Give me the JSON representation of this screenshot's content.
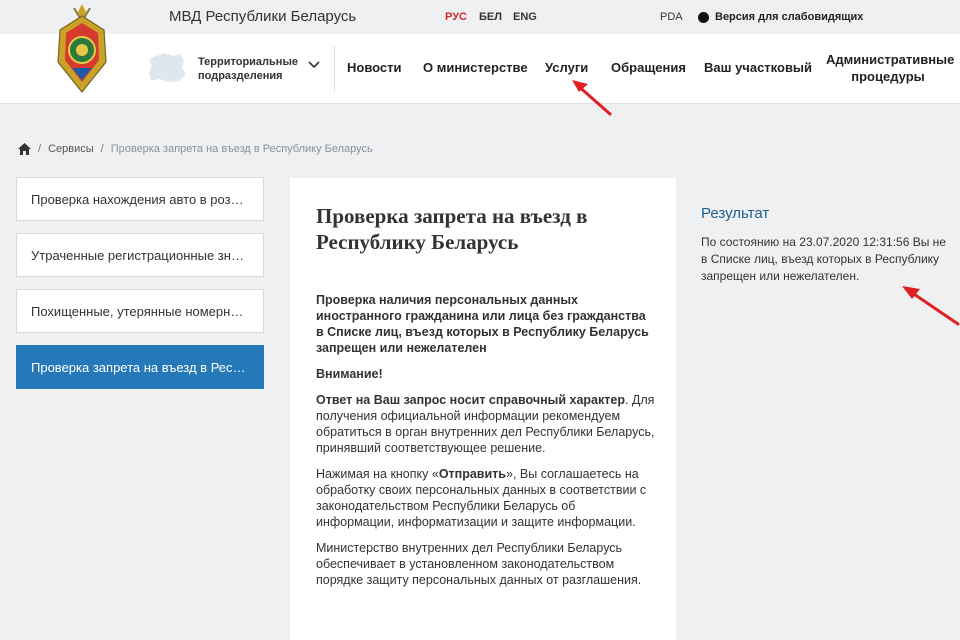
{
  "topbar": {
    "site_title": "МВД Республики Беларусь",
    "languages": [
      "РУС",
      "БЕЛ",
      "ENG"
    ],
    "active_language": "РУС",
    "pda_label": "PDA",
    "vision_label": "Версия для слабовидящих"
  },
  "header": {
    "territorial_line1": "Территориальные",
    "territorial_line2": "подразделения",
    "nav": [
      "Новости",
      "О министерстве",
      "Услуги",
      "Обращения",
      "Ваш участковый"
    ],
    "admin_line1": "Административные",
    "admin_line2": "процедуры"
  },
  "breadcrumb": {
    "services": "Сервисы",
    "current": "Проверка запрета на въезд в Республику Беларусь"
  },
  "sidebar": {
    "items": [
      {
        "label": "Проверка нахождения авто в розыске",
        "active": false
      },
      {
        "label": "Утраченные регистрационные знаки",
        "active": false
      },
      {
        "label": "Похищенные, утерянные номерные знаки",
        "active": false
      },
      {
        "label": "Проверка запрета на въезд в Республику Беларусь",
        "active": true
      }
    ]
  },
  "main": {
    "title": "Проверка запрета на въезд в Республику Беларусь",
    "intro_bold": "Проверка наличия персональных данных иностранного гражданина или лица без гражданства в Списке лиц, въезд которых в Республику Беларусь запрещен или нежелателен",
    "attention": "Внимание!",
    "reference_bold": "Ответ на Ваш запрос носит справочный характер",
    "reference_rest": ". Для получения официальной информации рекомендуем обратиться в орган внутренних дел Республики Беларусь, принявший соответствующее решение.",
    "consent_before": "Нажимая на кнопку «",
    "consent_button": "Отправить",
    "consent_after": "», Вы соглашаетесь на обработку своих персональных данных в соответствии с законодательством Республики Беларусь об информации, информатизации и защите информации.",
    "ministry_text": "Министерство внутренних дел Республики Беларусь обеспечивает в установленном законодательством порядке защиту персональных данных от разглашения."
  },
  "result": {
    "title": "Результат",
    "line1": "По состоянию на 23.07.2020 12:31:56 Вы не",
    "line2": "в Списке лиц, въезд которых в Республику",
    "line3": "запрещен или нежелателен."
  },
  "colors": {
    "accent_blue": "#2679b8",
    "active_language_red": "#d02a2a",
    "annotation_arrow_red": "#e02020",
    "result_title_blue": "#1f5e8e"
  }
}
